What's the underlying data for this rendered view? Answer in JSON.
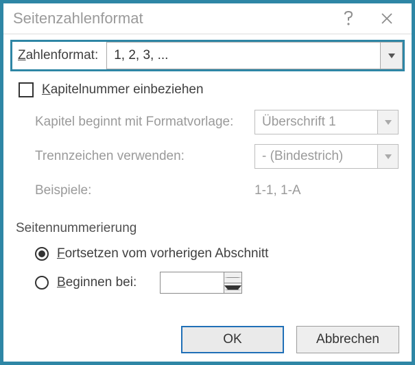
{
  "dialog": {
    "title": "Seitenzahlenformat"
  },
  "number_format": {
    "label_pre": "Z",
    "label_rest": "ahlenformat:",
    "value": "1, 2, 3, ..."
  },
  "chapter": {
    "checkbox_pre": "K",
    "checkbox_rest": "apitelnummer einbeziehen",
    "style_label": "Kapitel beginnt mit Formatvorlage:",
    "style_value": "Überschrift 1",
    "separator_label": "Trennzeichen verwenden:",
    "separator_value": "-    (Bindestrich)",
    "examples_label": "Beispiele:",
    "examples_value": "1-1, 1-A"
  },
  "numbering": {
    "section_title": "Seitennummerierung",
    "continue_pre": "F",
    "continue_rest": "ortsetzen vom vorherigen Abschnitt",
    "start_pre": "B",
    "start_rest": "eginnen bei:",
    "start_value": ""
  },
  "buttons": {
    "ok": "OK",
    "cancel": "Abbrechen"
  }
}
